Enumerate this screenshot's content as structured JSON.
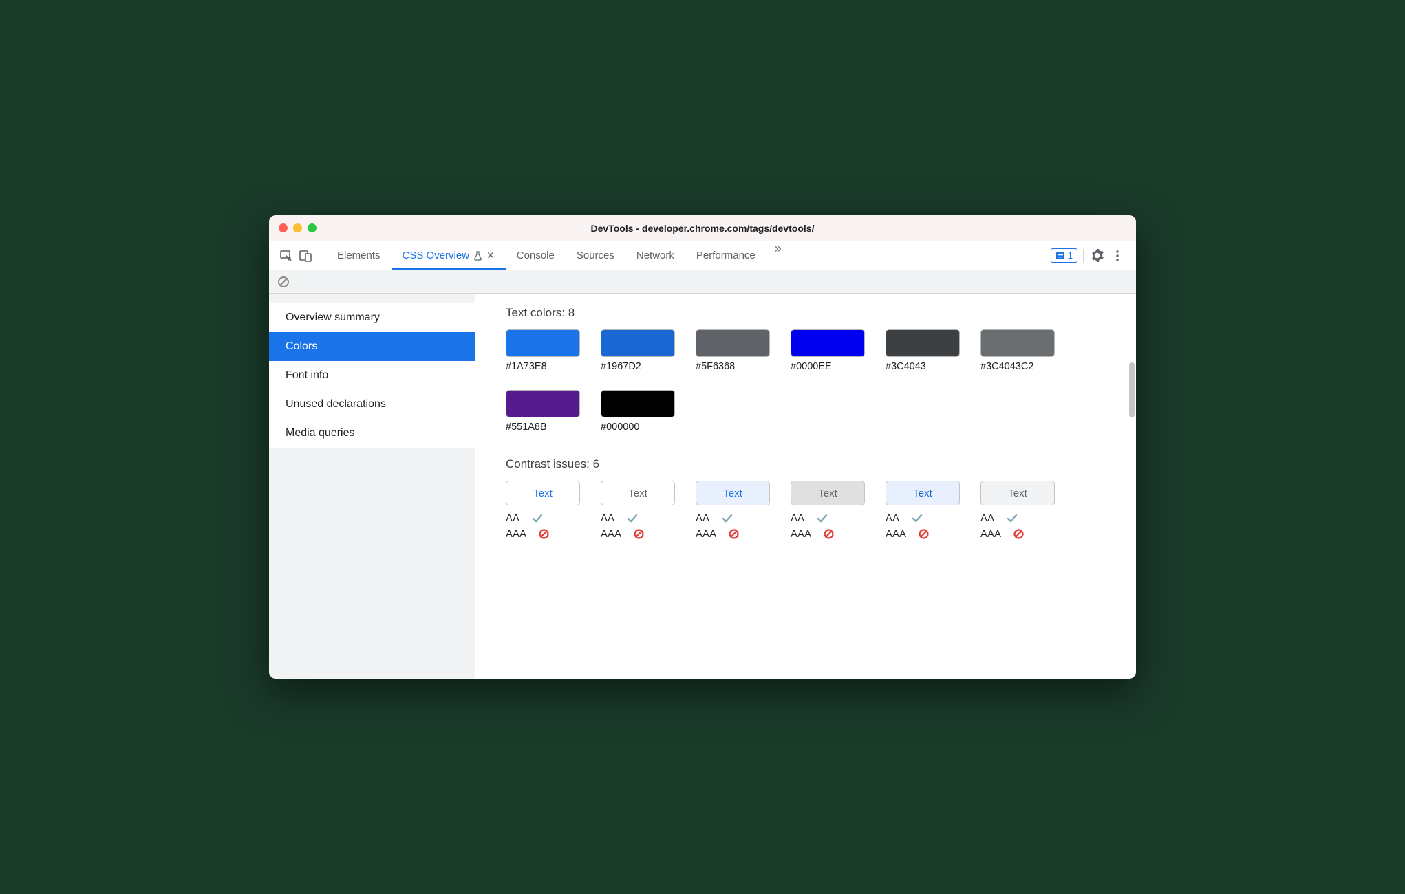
{
  "window": {
    "title": "DevTools - developer.chrome.com/tags/devtools/"
  },
  "toolbar": {
    "tabs": [
      {
        "label": "Elements",
        "active": false
      },
      {
        "label": "CSS Overview",
        "active": true,
        "experimental": true,
        "closable": true
      },
      {
        "label": "Console",
        "active": false
      },
      {
        "label": "Sources",
        "active": false
      },
      {
        "label": "Network",
        "active": false
      },
      {
        "label": "Performance",
        "active": false
      }
    ],
    "issues_count": "1"
  },
  "sidebar": {
    "items": [
      {
        "label": "Overview summary",
        "active": false
      },
      {
        "label": "Colors",
        "active": true
      },
      {
        "label": "Font info",
        "active": false
      },
      {
        "label": "Unused declarations",
        "active": false
      },
      {
        "label": "Media queries",
        "active": false
      }
    ]
  },
  "main": {
    "text_colors_heading": "Text colors: 8",
    "swatches": [
      {
        "hex": "#1A73E8",
        "color": "#1A73E8"
      },
      {
        "hex": "#1967D2",
        "color": "#1967D2"
      },
      {
        "hex": "#5F6368",
        "color": "#5F6368"
      },
      {
        "hex": "#0000EE",
        "color": "#0000EE"
      },
      {
        "hex": "#3C4043",
        "color": "#3C4043"
      },
      {
        "hex": "#3C4043C2",
        "color": "rgba(60,64,67,0.76)"
      },
      {
        "hex": "#551A8B",
        "color": "#551A8B"
      },
      {
        "hex": "#000000",
        "color": "#000000"
      }
    ],
    "contrast_heading": "Contrast issues: 6",
    "contrast": [
      {
        "text": "Text",
        "fg": "#1a73e8",
        "bg": "#ffffff",
        "aa": "pass",
        "aaa": "fail"
      },
      {
        "text": "Text",
        "fg": "#5f6368",
        "bg": "#ffffff",
        "aa": "pass",
        "aaa": "fail"
      },
      {
        "text": "Text",
        "fg": "#1a73e8",
        "bg": "#e8f0fe",
        "aa": "pass",
        "aaa": "fail"
      },
      {
        "text": "Text",
        "fg": "#5f6368",
        "bg": "#e0e0e0",
        "aa": "pass",
        "aaa": "fail"
      },
      {
        "text": "Text",
        "fg": "#1967d2",
        "bg": "#e8f0fe",
        "aa": "pass",
        "aaa": "fail"
      },
      {
        "text": "Text",
        "fg": "#5f6368",
        "bg": "#f1f3f4",
        "aa": "pass",
        "aaa": "fail"
      }
    ],
    "aa_label": "AA",
    "aaa_label": "AAA"
  }
}
